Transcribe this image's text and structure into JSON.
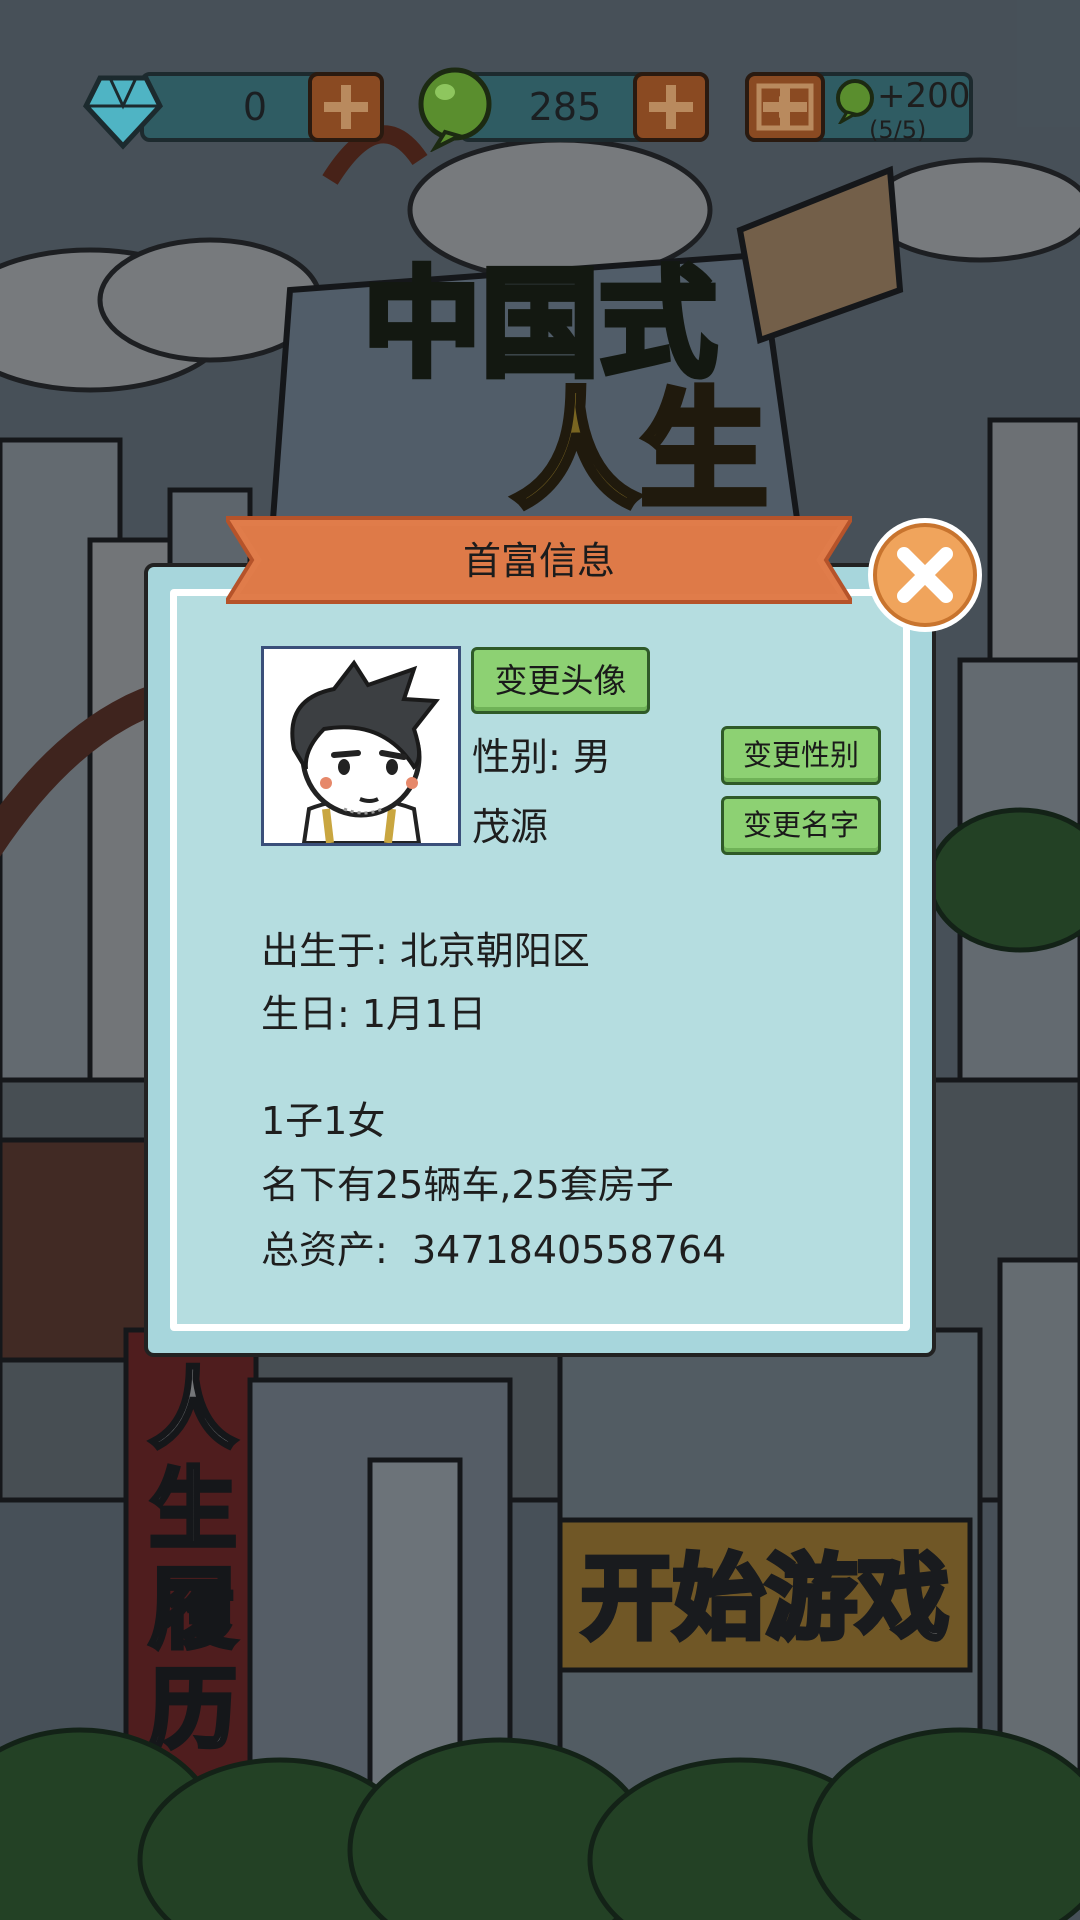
{
  "top_bar": {
    "gems": {
      "icon": "diamond-icon",
      "value": "0"
    },
    "coins": {
      "icon": "green-coin-icon",
      "value": "285"
    },
    "video_reward": {
      "icon": "video-play-icon",
      "reward": "+200",
      "count": "(5/5)"
    }
  },
  "background": {
    "logo_line1": "中国式",
    "logo_line2": "人生",
    "history_sign": "人生履历",
    "start_sign": "开始游戏"
  },
  "dialog": {
    "title": "首富信息",
    "close_icon": "close-icon",
    "change_avatar_label": "变更头像",
    "gender_text": "性别: 男",
    "change_gender_label": "变更性别",
    "name_text": "茂源",
    "change_name_label": "变更名字",
    "birthplace_text": "出生于: 北京朝阳区",
    "birthday_text": "生日: 1月1日",
    "children_text": "1子1女",
    "property_text": "名下有25辆车,25套房子",
    "assets_text": "总资产:  3471840558764"
  },
  "colors": {
    "dialog_bg": "#a7d6dc",
    "banner_orange": "#e07c4a",
    "close_orange": "#f0a45c",
    "button_green": "#8dd173"
  }
}
